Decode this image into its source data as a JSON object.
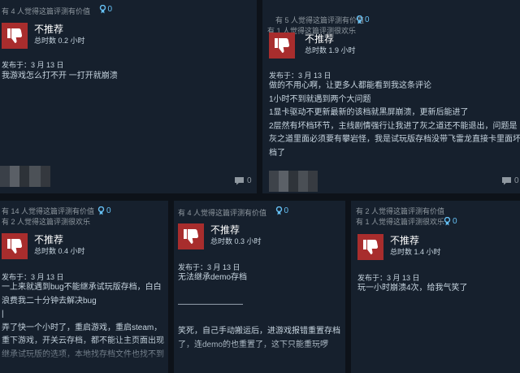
{
  "reviews": [
    {
      "helpful": "有 4 人觉得这篇评测有价值",
      "awards": "0",
      "verdict": "不推荐",
      "hours": "总时数 0.2 小时",
      "posted": "发布于：3 月 13 日",
      "text": "我游戏怎么打不开 一打开就崩溃",
      "comments": "0"
    },
    {
      "helpful": "有 5 人觉得这篇评测有价值\n有 1 人觉得这篇评测很欢乐",
      "awards": "0",
      "verdict": "不推荐",
      "hours": "总时数 1.9 小时",
      "posted": "发布于：3 月 13 日",
      "text": "做的不用心啊，让更多人都能看到我这条评论\n1小时不到就遇到两个大问题\n1显卡驱动不更新最新的该档就黑屏崩溃，更新后能进了\n2层然有坏档环节，主线剧情强行让我进了灰之道还不能退出，问题是\n灰之道里面必须要有攀岩怪，我是试玩版存档没带飞雷龙直接卡里面坏\n档了",
      "comments": "0"
    },
    {
      "helpful": "有 14 人觉得这篇评测有价值\n有 2 人觉得这篇评测很欢乐",
      "awards": "0",
      "verdict": "不推荐",
      "hours": "总时数 0.4 小时",
      "posted": "发布于：3 月 13 日",
      "text": "一上来就遇到bug不能继承试玩版存档，白白\n浪费我二十分钟去解决bug\n|\n弄了快一个小时了，重启游戏，重启steam，\n重下游戏，开关云存档，都不能让主页面出现\n继承试玩版的选项，本地找存档文件也找不到",
      "comments": ""
    },
    {
      "helpful": "有 4 人觉得这篇评测有价值",
      "awards": "0",
      "verdict": "不推荐",
      "hours": "总时数 0.3 小时",
      "posted": "发布于：3 月 13 日",
      "text": "无法继承demo存档\n\n————————\n\n笑死，自己手动搬运后，进游戏报错重置存档\n了，连demo的也重置了，这下只能重玩啰",
      "comments": ""
    },
    {
      "helpful": "有 2 人觉得这篇评测有价值\n有 1 人觉得这篇评测很欢乐",
      "awards": "0",
      "verdict": "不推荐",
      "hours": "总时数 1.4 小时",
      "posted": "发布于：3 月 13 日",
      "text": "玩一小时崩溃4次，给我气笑了",
      "comments": ""
    }
  ],
  "colors": {
    "thumb_bg": "#a82d2d",
    "accent": "#66c0f4",
    "card_bg": "#16202d",
    "page_bg": "#0d1219"
  },
  "icons": {
    "thumb": "thumbs-down-icon",
    "award": "award-icon",
    "comment": "comment-icon"
  }
}
